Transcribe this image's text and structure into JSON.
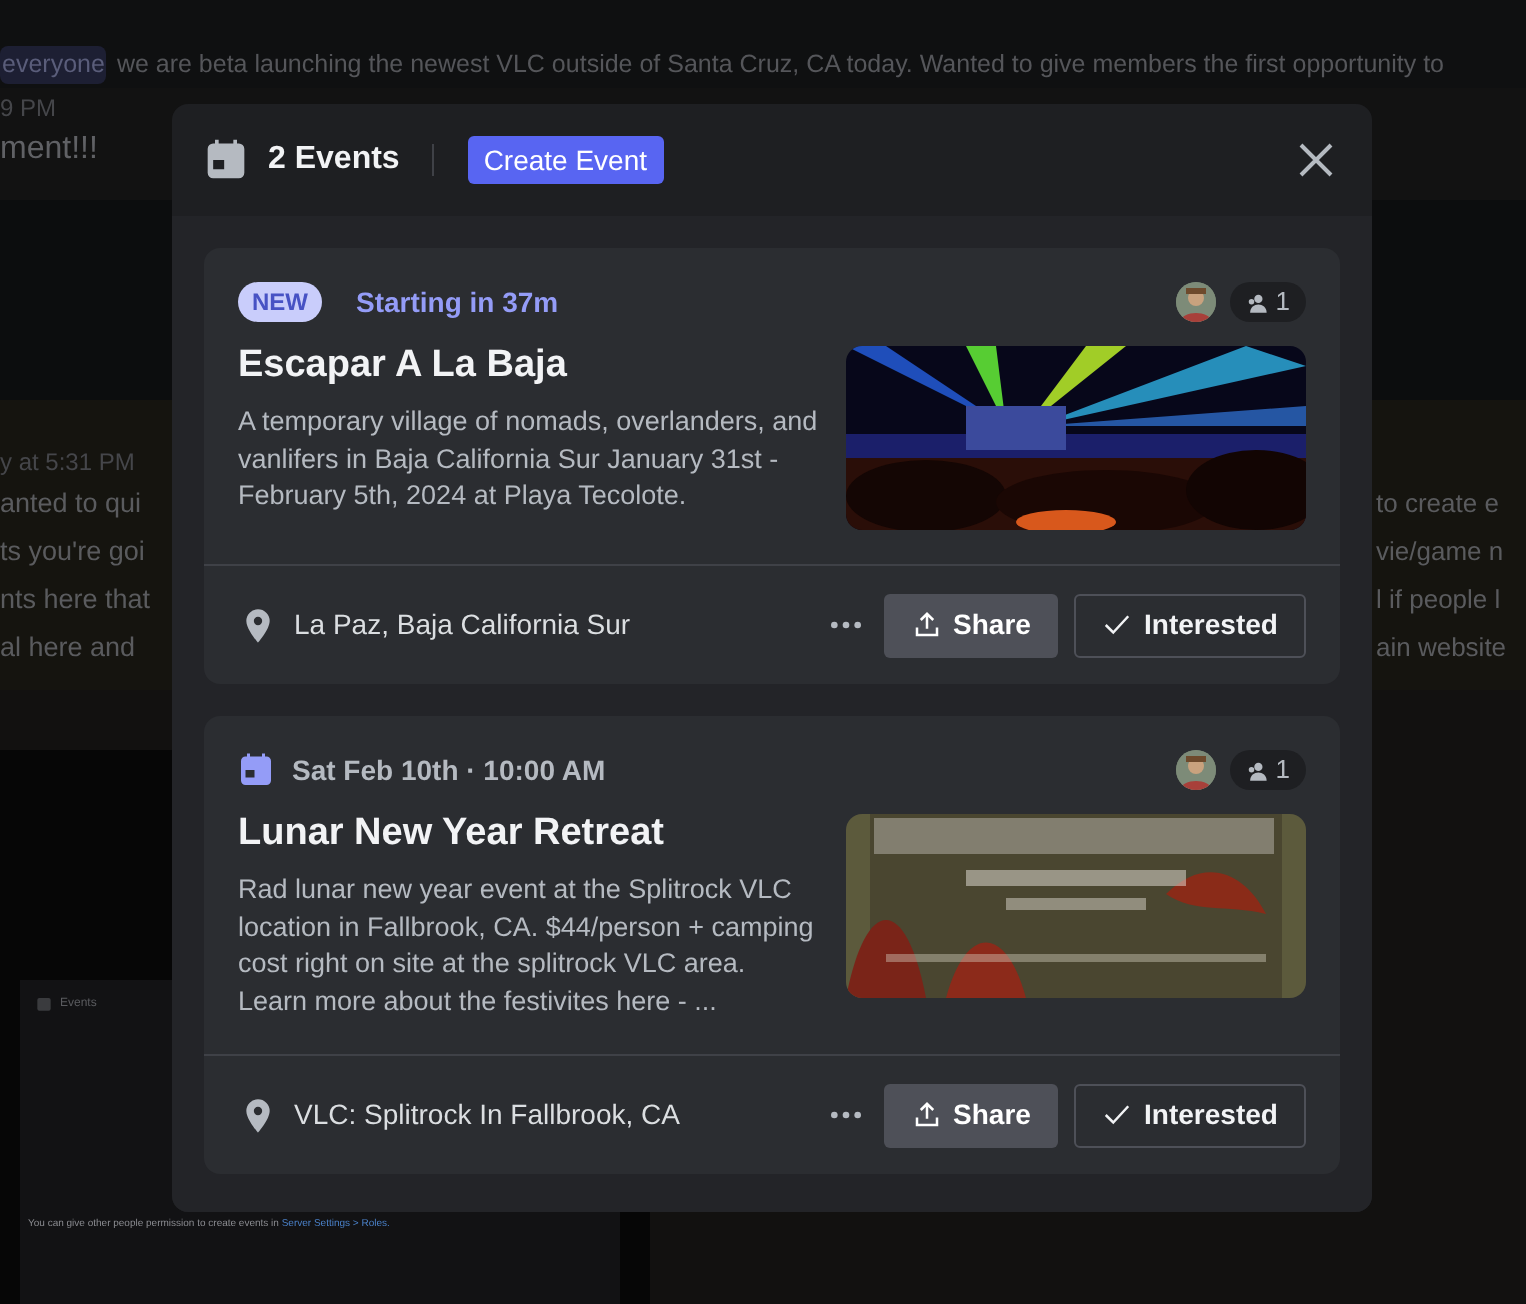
{
  "background": {
    "mention": "everyone",
    "message": "we are beta launching the newest VLC outside of Santa Cruz, CA today. Wanted to give members the first opportunity to",
    "time_1": "9 PM",
    "line_1": "ment!!!",
    "time_2": "y at 5:31 PM",
    "left_lines": [
      "anted to qui",
      "ts you're goi",
      "nts here that",
      "al here and"
    ],
    "right_lines": [
      "to create e",
      "vie/game n",
      "l if people l",
      "ain website"
    ],
    "embedded_window": {
      "title": "Events",
      "note": "You can give other people permission to create events in",
      "note_link": "Server Settings > Roles."
    }
  },
  "modal": {
    "title": "2 Events",
    "create_button": "Create Event",
    "events": [
      {
        "kind": "starting",
        "badge": "NEW",
        "when": "Starting in 37m",
        "title": "Escapar A La Baja",
        "description": "A temporary village of nomads, overlanders, and vanlifers in Baja California Sur January 31st - February 5th, 2024 at Playa Tecolote.",
        "location": "La Paz, Baja California Sur",
        "interested_count": "1",
        "share": "Share",
        "interested": "Interested"
      },
      {
        "kind": "scheduled",
        "when": "Sat Feb 10th · 10:00 AM",
        "title": "Lunar New Year Retreat",
        "description": "Rad lunar new year event at the Splitrock VLC location in Fallbrook, CA. $44/person + camping cost right on site at the splitrock VLC area. Learn more about the festivites here - ...",
        "location": "VLC: Splitrock In Fallbrook, CA",
        "interested_count": "1",
        "share": "Share",
        "interested": "Interested"
      }
    ]
  }
}
